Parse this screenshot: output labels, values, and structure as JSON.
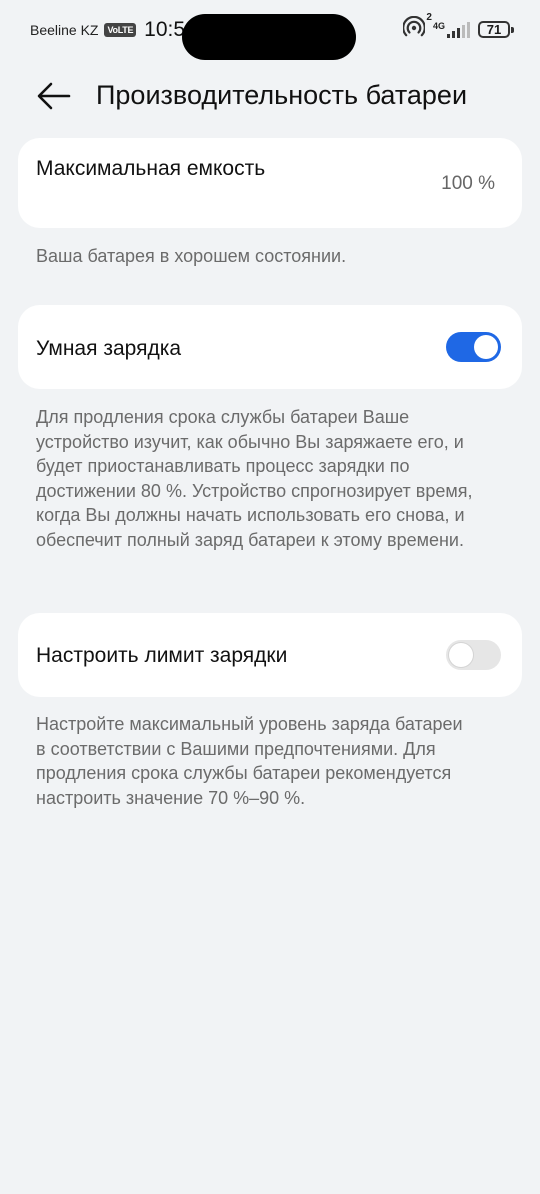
{
  "status_bar": {
    "carrier": "Beeline KZ",
    "volte": "VoLTE",
    "time": "10:52",
    "network": "4G",
    "hotspot_superscript": "2",
    "battery": "71"
  },
  "header": {
    "back_icon": "arrow-left-icon",
    "title": "Производительность батареи"
  },
  "capacity": {
    "label": "Максимальная емкость",
    "value": "100 %"
  },
  "capacity_desc": "Ваша батарея в хорошем состоянии.",
  "smart_charging": {
    "label": "Умная зарядка",
    "enabled": true,
    "description": "Для продления срока службы батареи Ваше устройство изучит, как обычно Вы заряжаете его, и будет приостанавливать процесс зарядки по достижении 80 %. Устройство спрогнозирует время, когда Вы должны начать использовать его снова, и обеспечит полный заряд батареи к этому времени."
  },
  "charge_limit": {
    "label": "Настроить лимит зарядки",
    "enabled": false,
    "description": "Настройте максимальный уровень заряда батареи в соответствии с Вашими предпочтениями. Для продления срока службы батареи рекомендуется настроить значение 70 %–90 %."
  },
  "colors": {
    "accent": "#1f68e5",
    "background": "#f1f3f5",
    "card": "#ffffff"
  }
}
